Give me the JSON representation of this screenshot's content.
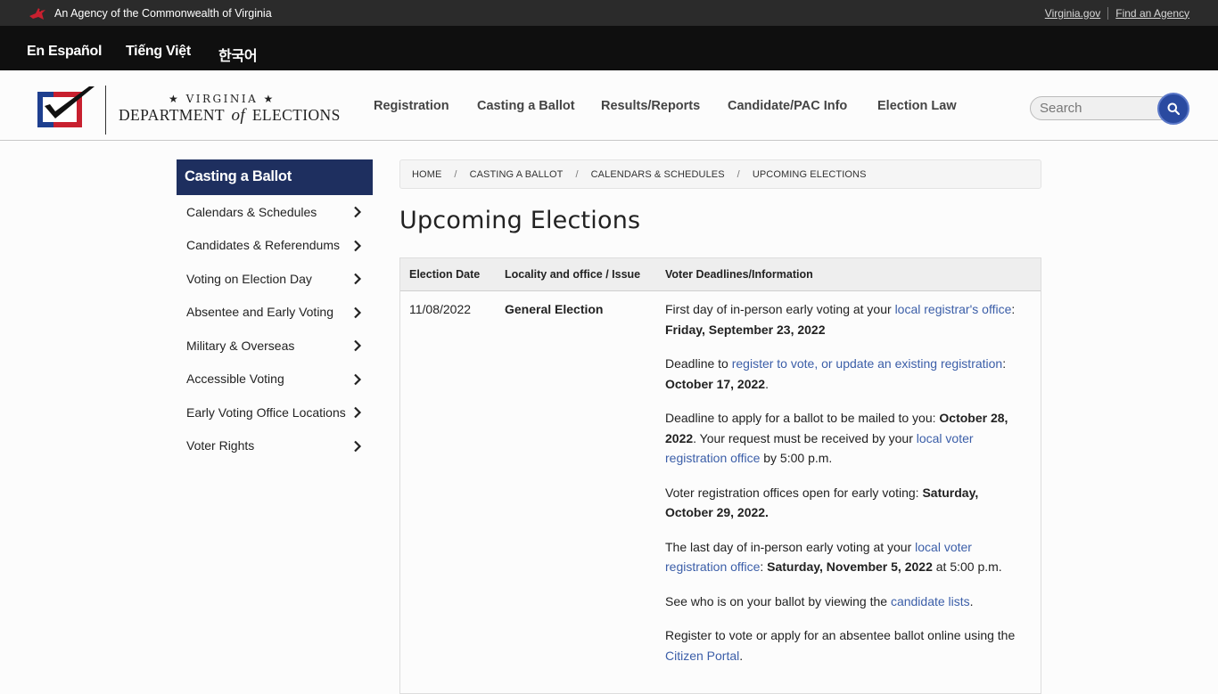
{
  "agency_bar": {
    "agency_text": "An Agency of the Commonwealth of Virginia",
    "link_virginia": "Virginia.gov",
    "link_find_agency": "Find an Agency"
  },
  "languages": [
    "En Español",
    "Tiếng Việt",
    "한국어"
  ],
  "logo": {
    "line1": "★ VIRGINIA ★",
    "dept_a": "DEPARTMENT",
    "dept_of": "of",
    "dept_b": "ELECTIONS"
  },
  "nav": {
    "items": [
      "Registration",
      "Casting a Ballot",
      "Results/Reports",
      "Candidate/PAC Info",
      "Election Law"
    ]
  },
  "search": {
    "placeholder": "Search"
  },
  "sidebar": {
    "title": "Casting a Ballot",
    "items": [
      "Calendars & Schedules",
      "Candidates & Referendums",
      "Voting on Election Day",
      "Absentee and Early Voting",
      "Military & Overseas",
      "Accessible Voting",
      "Early Voting Office Locations",
      "Voter Rights"
    ]
  },
  "breadcrumb": [
    "HOME",
    "CASTING A BALLOT",
    "CALENDARS & SCHEDULES",
    "UPCOMING ELECTIONS"
  ],
  "page_title": "Upcoming Elections",
  "table": {
    "headers": [
      "Election Date",
      "Locality and office / Issue",
      "Voter Deadlines/Information"
    ],
    "row": {
      "date": "11/08/2022",
      "office": "General Election",
      "p1_text": "First day of in-person early voting at your ",
      "p1_link": "local registrar's office",
      "p1_sep": ": ",
      "p1_bold": "Friday, September 23, 2022",
      "p2_text": "Deadline to ",
      "p2_link": "register to vote, or update an existing registration",
      "p2_sep": ": ",
      "p2_bold": "October 17, 2022",
      "p2_end": ".",
      "p3_text": "Deadline to apply for a ballot to be mailed to you: ",
      "p3_bold": "October 28, 2022",
      "p3_mid": ". Your request must be received by your ",
      "p3_link": "local voter registration office",
      "p3_end": " by 5:00 p.m.",
      "p4_text": "Voter registration offices open for early voting: ",
      "p4_bold": "Saturday, October 29, 2022.",
      "p5_text": "The last day of in-person early voting at your ",
      "p5_link": "local voter registration office",
      "p5_sep": ":  ",
      "p5_bold": "Saturday, November 5, 2022",
      "p5_end": " at 5:00 p.m.",
      "p6_text": "See who is on your ballot by viewing the ",
      "p6_link": "candidate lists",
      "p6_end": ".",
      "p7_text": "Register to vote or apply for an absentee ballot online using the ",
      "p7_link": "Citizen Portal",
      "p7_end": "."
    }
  },
  "colors": {
    "sidebar_title_bg": "#1e2f5f",
    "link": "#3b5ea8",
    "search_button": "#2a4aa0",
    "logo_red": "#c8202f",
    "logo_blue": "#1e3f8f"
  }
}
